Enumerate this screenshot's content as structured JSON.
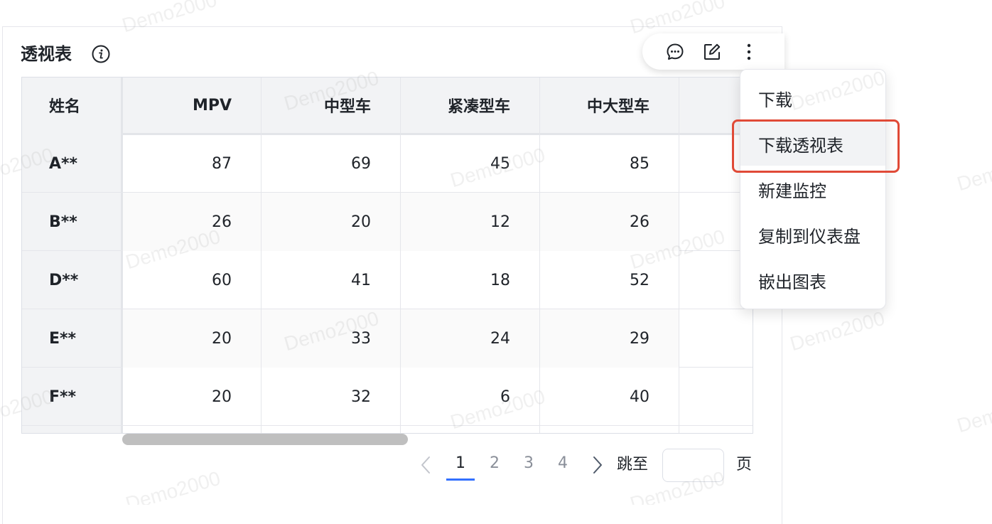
{
  "widget": {
    "title": "透视表"
  },
  "toolbar": {
    "icons": [
      "comment-icon",
      "edit-icon",
      "more-icon"
    ]
  },
  "table": {
    "columns": [
      "姓名",
      "MPV",
      "中型车",
      "紧凑型车",
      "中大型车",
      ""
    ],
    "rows": [
      {
        "name": "A**",
        "values": [
          "87",
          "69",
          "45",
          "85",
          ""
        ]
      },
      {
        "name": "B**",
        "values": [
          "26",
          "20",
          "12",
          "26",
          ""
        ]
      },
      {
        "name": "D**",
        "values": [
          "60",
          "41",
          "18",
          "52",
          ""
        ]
      },
      {
        "name": "E**",
        "values": [
          "20",
          "33",
          "24",
          "29",
          ""
        ]
      },
      {
        "name": "F**",
        "values": [
          "20",
          "32",
          "6",
          "40",
          ""
        ]
      }
    ]
  },
  "pagination": {
    "pages": [
      "1",
      "2",
      "3",
      "4"
    ],
    "current": "1",
    "jump_label": "跳至",
    "jump_value": "",
    "page_suffix": "页"
  },
  "menu": {
    "items": [
      "下载",
      "下载透视表",
      "新建监控",
      "复制到仪表盘",
      "嵌出图表"
    ],
    "highlighted_index": 1
  },
  "watermark": {
    "text": "Demo2000"
  },
  "colors": {
    "accent": "#3370ff",
    "highlight_border": "#e04a37",
    "header_bg": "#f2f3f5"
  }
}
